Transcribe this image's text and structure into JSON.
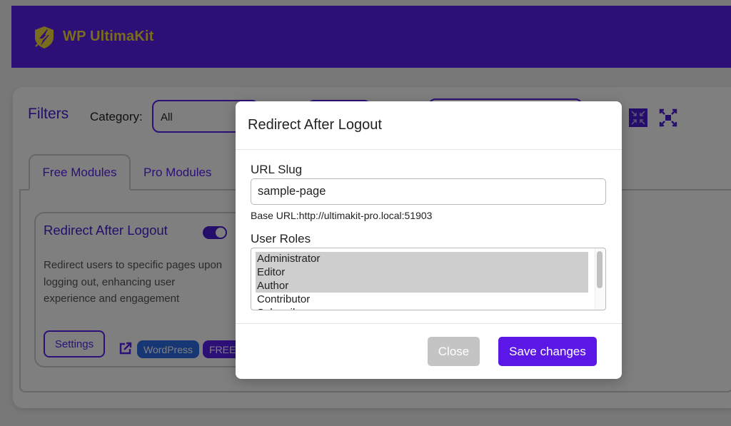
{
  "app": {
    "brand": "WP UltimaKit",
    "colors": {
      "brand_bg": "#5b1ef0",
      "brand_text": "#f5d83f",
      "accent": "#5b17e6",
      "wordpress_badge": "#2f6fe8"
    }
  },
  "filters": {
    "title": "Filters",
    "category_label": "Category:",
    "category_value": "All",
    "view_icons": [
      "collapse-grid-icon",
      "expand-icon"
    ]
  },
  "tabs": [
    {
      "label": "Free Modules",
      "active": true
    },
    {
      "label": "Pro Modules",
      "active": false
    }
  ],
  "module_card": {
    "title": "Redirect After Logout",
    "enabled": true,
    "description": "Redirect users to specific pages upon logging out, enhancing user experience and engagement",
    "settings_label": "Settings",
    "badges": [
      "WordPress",
      "FREE"
    ]
  },
  "modal": {
    "title": "Redirect After Logout",
    "url_slug_label": "URL Slug",
    "url_slug_value": "sample-page",
    "base_url_text": "Base URL:http://ultimakit-pro.local:51903",
    "user_roles_label": "User Roles",
    "user_roles": [
      {
        "label": "Administrator",
        "selected": true
      },
      {
        "label": "Editor",
        "selected": true
      },
      {
        "label": "Author",
        "selected": true
      },
      {
        "label": "Contributor",
        "selected": false
      },
      {
        "label": "Subscriber",
        "selected": false
      }
    ],
    "close_label": "Close",
    "save_label": "Save changes"
  }
}
